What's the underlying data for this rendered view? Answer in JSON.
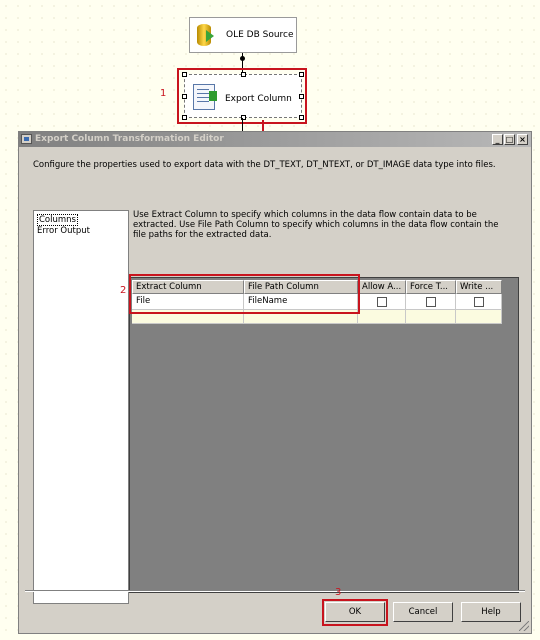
{
  "canvas": {
    "source_node": {
      "label": "OLE DB Source",
      "icon": "database-cylinder-icon"
    },
    "export_node": {
      "label": "Export Column",
      "icon": "export-column-icon"
    },
    "annotation_1": "1"
  },
  "dialog": {
    "title": "Export Column Transformation Editor",
    "window_buttons": {
      "minimize": "_",
      "maximize": "□",
      "close": "×"
    },
    "description": "Configure the properties used to export data with the DT_TEXT, DT_NTEXT, or DT_IMAGE data type into files.",
    "nav": {
      "items": [
        "Columns",
        "Error Output"
      ],
      "selected": "Columns"
    },
    "instructions": "Use Extract Column to specify which columns in the data flow contain data to be extracted. Use File Path Column to specify which columns in the data flow contain the file paths for the extracted data.",
    "grid": {
      "columns": [
        "Extract Column",
        "File Path Column",
        "Allow A...",
        "Force T...",
        "Write ..."
      ],
      "rows": [
        {
          "extract_column": "File",
          "file_path_column": "FileName",
          "allow_append": false,
          "force_truncate": false,
          "write_bom": false
        }
      ]
    },
    "annotation_2": "2",
    "annotation_3": "3",
    "buttons": {
      "ok": "OK",
      "cancel": "Cancel",
      "help": "Help"
    },
    "colors": {
      "annotation_red": "#c8141e",
      "dialog_face": "#d4d0c8",
      "new_row": "#fbfbe0"
    }
  }
}
